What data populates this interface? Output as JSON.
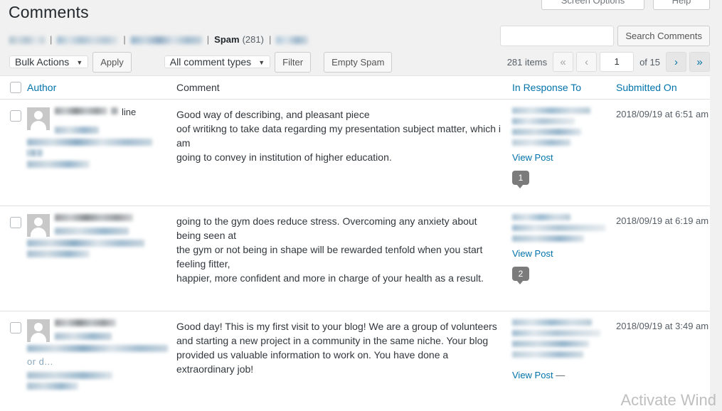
{
  "page": {
    "title": "Comments"
  },
  "top_buttons": {
    "screen_options": "Screen Options",
    "help": "Help"
  },
  "filters": {
    "separator": "|",
    "spam_label": "Spam",
    "spam_count": "(281)"
  },
  "toolbar": {
    "bulk_actions": "Bulk Actions",
    "apply": "Apply",
    "comment_types": "All comment types",
    "filter": "Filter",
    "empty_spam": "Empty Spam",
    "caret": "▼"
  },
  "search": {
    "value": "",
    "placeholder": "",
    "button": "Search Comments"
  },
  "pagination": {
    "items": "281 items",
    "first": "«",
    "prev": "‹",
    "current": "1",
    "of_total": "of 15",
    "next": "›",
    "last": "»"
  },
  "table": {
    "columns": {
      "author": "Author",
      "comment": "Comment",
      "in_response_to": "In Response To",
      "submitted_on": "Submitted On"
    },
    "rows": [
      {
        "author_name_suffix": "line",
        "comment": "Good way of describing, and pleasant piece\noof writikng to take data regarding my presentation subject matter, which i am\ngoing to convey in institution of higher education.",
        "view_post": "View Post",
        "comment_count": "1",
        "submitted_on": "2018/09/19 at 6:51 am"
      },
      {
        "author_name_suffix": "",
        "comment": "going to the gym does reduce stress. Overcoming any anxiety about being seen at\nthe gym or not being in shape will be rewarded tenfold when you start feeling fitter,\nhappier, more confident and more in charge of your health as a result.",
        "view_post": "View Post",
        "comment_count": "2",
        "submitted_on": "2018/09/19 at 6:19 am"
      },
      {
        "author_name_suffix": "",
        "author_url_tail": "or d...",
        "comment": "Good day! This is my first visit to your blog! We are a group of volunteers and starting a new project in a community in the same niche. Your blog provided us valuable information to work on. You have done a extraordinary job!",
        "view_post": "View Post",
        "comment_count": "—",
        "submitted_on": "2018/09/19 at 3:49 am"
      }
    ]
  },
  "watermark": "Activate Wind"
}
